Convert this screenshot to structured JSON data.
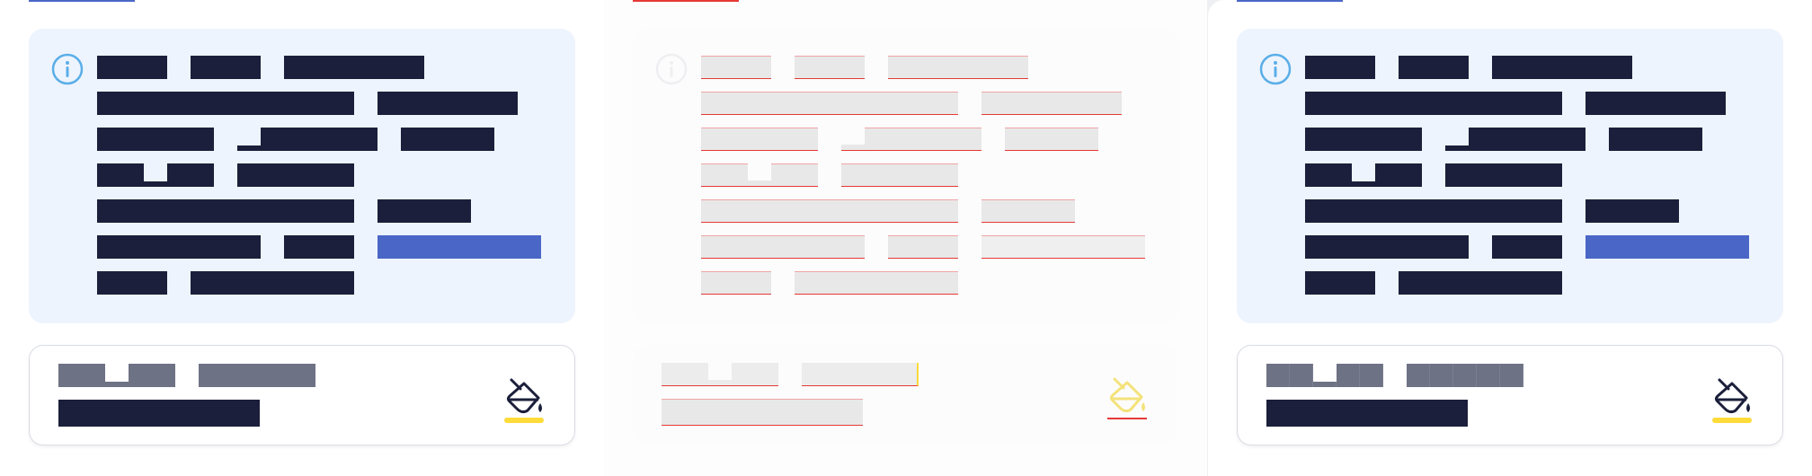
{
  "colors": {
    "info_background": "#edf4fd",
    "redacted_text": "#1b1f3b",
    "highlight_bar": "#4a67c7",
    "muted_text": "#6e7285",
    "info_icon": "#5aaee8",
    "paint_icon_accent": "#ffdb3a",
    "debug_outline": "#e53935"
  },
  "icons": {
    "info": "info-circle-icon",
    "paint": "paint-bucket-icon"
  },
  "panels": [
    {
      "id": "original",
      "variant": "normal"
    },
    {
      "id": "overlay",
      "variant": "outlined"
    },
    {
      "id": "copy",
      "variant": "normal"
    }
  ]
}
